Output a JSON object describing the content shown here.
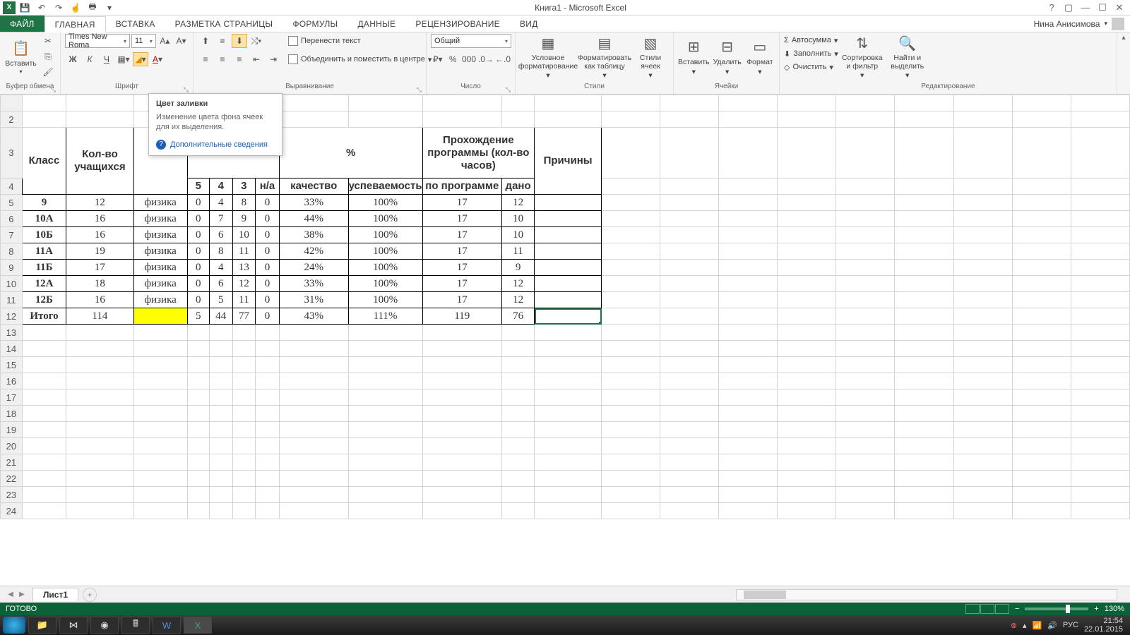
{
  "title": "Книга1 - Microsoft Excel",
  "user": "Нина Анисимова",
  "tabs": {
    "file": "ФАЙЛ",
    "home": "ГЛАВНАЯ",
    "insert": "ВСТАВКА",
    "layout": "РАЗМЕТКА СТРАНИЦЫ",
    "formulas": "ФОРМУЛЫ",
    "data": "ДАННЫЕ",
    "review": "РЕЦЕНЗИРОВАНИЕ",
    "view": "ВИД"
  },
  "ribbon": {
    "clipboard": {
      "paste": "Вставить",
      "label": "Буфер обмена"
    },
    "font": {
      "name": "Times New Roma",
      "size": "11",
      "bold": "Ж",
      "italic": "К",
      "underline": "Ч",
      "label": "Шрифт"
    },
    "align": {
      "wrap": "Перенести текст",
      "merge": "Объединить и поместить в центре",
      "label": "Выравнивание"
    },
    "number": {
      "format": "Общий",
      "label": "Число"
    },
    "styles": {
      "cond": "Условное форматирование",
      "table": "Форматировать как таблицу",
      "cell": "Стили ячеек",
      "label": "Стили"
    },
    "cells": {
      "insert": "Вставить",
      "delete": "Удалить",
      "format": "Формат",
      "label": "Ячейки"
    },
    "editing": {
      "sum": "Автосумма",
      "fill": "Заполнить",
      "clear": "Очистить",
      "sort": "Сортировка и фильтр",
      "find": "Найти и выделить",
      "label": "Редактирование"
    }
  },
  "tooltip": {
    "title": "Цвет заливки",
    "desc": "Изменение цвета фона ячеек для их выделения.",
    "more": "Дополнительные сведения"
  },
  "sheet": {
    "headers": {
      "class": "Класс",
      "students": "Кол-во учащихся",
      "percent": "%",
      "program": "Прохождение программы (кол-во часов)",
      "reasons": "Причины",
      "g5": "5",
      "g4": "4",
      "g3": "3",
      "na": "н/а",
      "quality": "качество",
      "progress": "успеваемость",
      "by_program": "по программе",
      "given": "дано"
    },
    "rows": [
      {
        "class": "9",
        "students": "12",
        "subj": "физика",
        "g5": "0",
        "g4": "4",
        "g3": "8",
        "na": "0",
        "quality": "33%",
        "progress": "100%",
        "prog": "17",
        "given": "12"
      },
      {
        "class": "10А",
        "students": "16",
        "subj": "физика",
        "g5": "0",
        "g4": "7",
        "g3": "9",
        "na": "0",
        "quality": "44%",
        "progress": "100%",
        "prog": "17",
        "given": "10"
      },
      {
        "class": "10Б",
        "students": "16",
        "subj": "физика",
        "g5": "0",
        "g4": "6",
        "g3": "10",
        "na": "0",
        "quality": "38%",
        "progress": "100%",
        "prog": "17",
        "given": "10"
      },
      {
        "class": "11А",
        "students": "19",
        "subj": "физика",
        "g5": "0",
        "g4": "8",
        "g3": "11",
        "na": "0",
        "quality": "42%",
        "progress": "100%",
        "prog": "17",
        "given": "11"
      },
      {
        "class": "11Б",
        "students": "17",
        "subj": "физика",
        "g5": "0",
        "g4": "4",
        "g3": "13",
        "na": "0",
        "quality": "24%",
        "progress": "100%",
        "prog": "17",
        "given": "9"
      },
      {
        "class": "12А",
        "students": "18",
        "subj": "физика",
        "g5": "0",
        "g4": "6",
        "g3": "12",
        "na": "0",
        "quality": "33%",
        "progress": "100%",
        "prog": "17",
        "given": "12"
      },
      {
        "class": "12Б",
        "students": "16",
        "subj": "физика",
        "g5": "0",
        "g4": "5",
        "g3": "11",
        "na": "0",
        "quality": "31%",
        "progress": "100%",
        "prog": "17",
        "given": "12"
      }
    ],
    "total": {
      "class": "Итого",
      "students": "114",
      "subj": "",
      "g5": "5",
      "g4": "44",
      "g3": "77",
      "na": "0",
      "quality": "43%",
      "progress": "111%",
      "prog": "119",
      "given": "76"
    },
    "tab": "Лист1"
  },
  "status": {
    "ready": "ГОТОВО",
    "zoom": "130%"
  },
  "taskbar": {
    "lang": "РУС",
    "time": "21:54",
    "date": "22.01.2015"
  }
}
